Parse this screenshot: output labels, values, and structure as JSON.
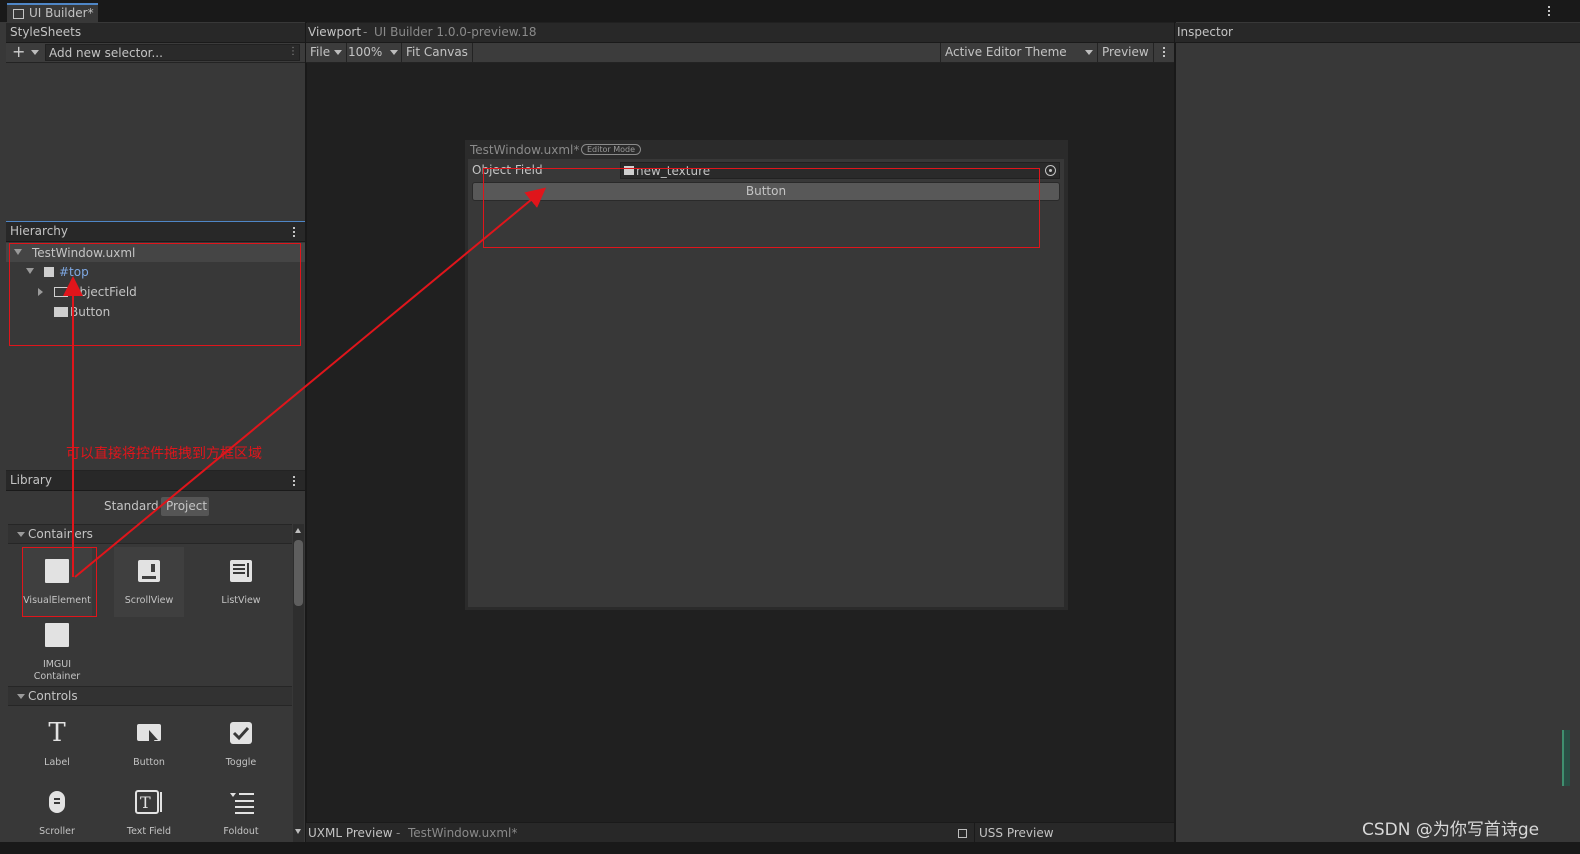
{
  "window": {
    "tab_title": "UI Builder*"
  },
  "stylesheets": {
    "title": "StyleSheets",
    "add_selector_placeholder": "Add new selector..."
  },
  "hierarchy": {
    "title": "Hierarchy",
    "root": "TestWindow.uxml",
    "items": [
      {
        "label": "#top"
      },
      {
        "label": "ObjectField"
      },
      {
        "label": "Button"
      }
    ]
  },
  "library": {
    "title": "Library",
    "tabs": [
      "Standard",
      "Project"
    ],
    "sections": [
      {
        "title": "Containers",
        "items": [
          "VisualElement",
          "ScrollView",
          "ListView",
          "IMGUI\nContainer"
        ]
      },
      {
        "title": "Controls",
        "items": [
          "Label",
          "Button",
          "Toggle",
          "Scroller",
          "Text Field",
          "Foldout"
        ]
      }
    ]
  },
  "viewport": {
    "title": "Viewport",
    "subtitle": "UI Builder 1.0.0-preview.18",
    "toolbar": {
      "file": "File",
      "zoom": "100%",
      "fit": "Fit Canvas",
      "theme": "Active Editor Theme",
      "preview": "Preview"
    },
    "canvas": {
      "title": "TestWindow.uxml*",
      "badge": "Editor Mode",
      "object_field_label": "Object Field",
      "object_field_value": "new_texture",
      "button_label": "Button"
    }
  },
  "inspector": {
    "title": "Inspector"
  },
  "footer": {
    "uxml_preview": "UXML Preview",
    "uxml_file": "TestWindow.uxml*",
    "uss_preview": "USS Preview"
  },
  "annotation": {
    "text": "可以直接将控件拖拽到方框区域"
  },
  "watermark": "CSDN @为你写首诗ge",
  "colors": {
    "annotation_red": "#e0151b",
    "accent_blue": "#4f86c6",
    "panel_bg": "#383838",
    "viewport_bg": "#202020"
  }
}
